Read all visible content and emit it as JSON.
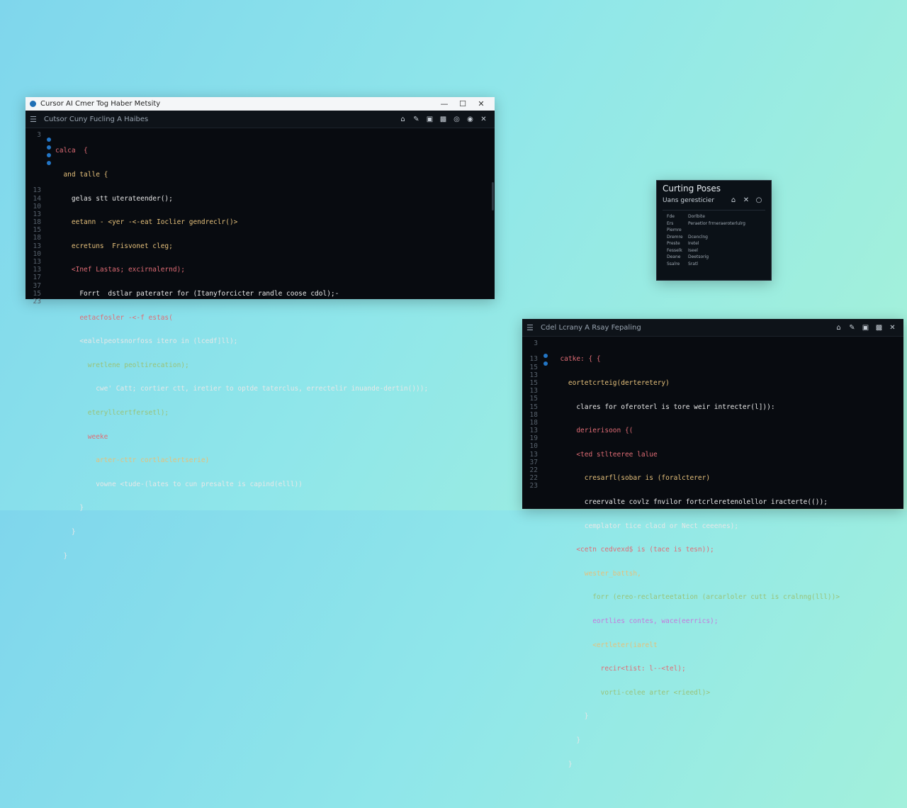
{
  "main_window": {
    "title": "Cursor AI Cmer Tog Haber Metsity",
    "controls": {
      "minimize": "—",
      "maximize": "☐",
      "close": "✕"
    },
    "toolbar_title": "Cutsor Cuny Fucling A Haibes",
    "toolbar_icons": [
      "⌂",
      "✎",
      "▣",
      "▩",
      "◎",
      "◉",
      "✕"
    ],
    "line_numbers": [
      "3",
      "",
      "",
      "",
      "",
      "",
      "",
      "13",
      "14",
      "10",
      "13",
      "18",
      "15",
      "18",
      "13",
      "10",
      "13",
      "13",
      "17",
      "37",
      "15",
      "23"
    ],
    "code_lines": [
      "calca  {",
      "  and talle {",
      "    gelas stt uterateender();",
      "    eetann - <yer -<-eat Ioclier gendreclr()>",
      "    ecretuns  Frisvonet cleg;",
      "    <Inef Lastas; excirnalernd);",
      "      Forrt  dstlar paterater for (Itanyforcicter randle coose cdol);-",
      "      eetacfosler -<-f estas(",
      "      <ealelpeotsnorfoss itero in (lcedf]ll);",
      "        wretlene peoltirecation);",
      "          cwe' Catt; cortier ctt, iretier to optde taterclus, errectelir inuande-dertin()));",
      "        eteryllcertfersetl);",
      "        weeke",
      "          arter-cttr cortlaclertserie)",
      "          vowne <tude-(lates to cun presalte is capind(elll))",
      "      }",
      "    }",
      "  }",
      "",
      "",
      "",
      ""
    ]
  },
  "popup": {
    "title": "Curting Poses",
    "subtitle": "Uans geresticier",
    "icons": [
      "⌂",
      "✕",
      "○"
    ],
    "properties": [
      {
        "key": "Fde",
        "value": "Dorlbite"
      },
      {
        "key": "Ers",
        "value": "Peraetlor frrneraeroterlulrg"
      },
      {
        "key": "Piemre",
        "value": ""
      },
      {
        "key": "Dremre",
        "value": "Dcenclng"
      },
      {
        "key": "Preste",
        "value": "Iretel"
      },
      {
        "key": "Fesselk",
        "value": "Iseel"
      },
      {
        "key": "Deane",
        "value": "Deetsorig"
      },
      {
        "key": "Ssalre",
        "value": "Sratl"
      }
    ]
  },
  "second_window": {
    "toolbar_title": "Cdel Lcrany A Rsay Fepaling",
    "toolbar_icons": [
      "⌂",
      "✎",
      "▣",
      "▩",
      "✕"
    ],
    "line_numbers": [
      "3",
      "",
      "13",
      "15",
      "13",
      "15",
      "13",
      "15",
      "15",
      "18",
      "18",
      "13",
      "19",
      "10",
      "13",
      "37",
      "22",
      "22",
      "23"
    ],
    "code_lines": [
      "  catke: { {",
      "    eortetcrteig(derteretery)",
      "      clares for oferoterl is tore weir intrecter(l])):",
      "      derierisoon {(",
      "      <ted stlteeree lalue",
      "        cresarfl(sobar is (foralcterer)",
      "        creervalte covlz fnvilor fortcrleretenolellor iracterte(());",
      "        cemplator tice clacd or Nect ceeenes);",
      "      <cetn cedvexd$ is (tace is tesn));",
      "        wester_battsh,",
      "          forr (ereo-reclarteetation (arcarloler cutt is cralnng(lll))>",
      "          eortlies contes, wace(eerrics);",
      "          <ertleter(iarelt",
      "            recir<tist: l--<tel);",
      "            vorti-celee arter <rieedl)>",
      "        }",
      "      }",
      "    }",
      ""
    ]
  },
  "colors": {
    "background_start": "#7fd6ec",
    "background_end": "#a6f2d8",
    "editor_bg": "#080b10",
    "keyword": "#e06c75",
    "string": "#98c379",
    "accent": "#2376c6"
  }
}
